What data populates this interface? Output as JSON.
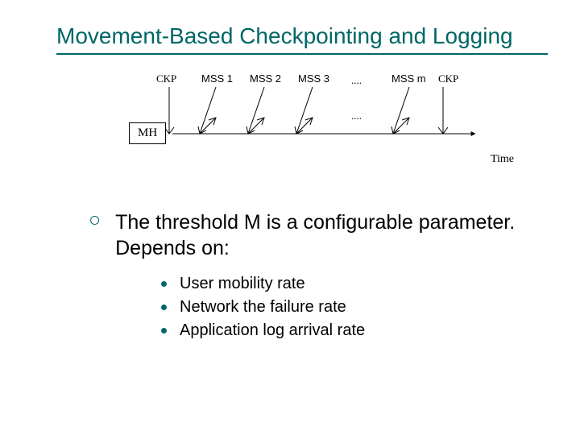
{
  "title": "Movement-Based Checkpointing and Logging",
  "diagram": {
    "ckp_left": "CKP",
    "ckp_right": "CKP",
    "mss_labels": [
      "MSS 1",
      "MSS 2",
      "MSS 3",
      "MSS m"
    ],
    "dots_top": "....",
    "dots_mid": "....",
    "mh_label": "MH",
    "time_label": "Time"
  },
  "bullet": {
    "text": "The threshold M is a configurable parameter. Depends on:",
    "subs": [
      "User mobility rate",
      "Network the failure rate",
      "Application log arrival rate"
    ]
  }
}
